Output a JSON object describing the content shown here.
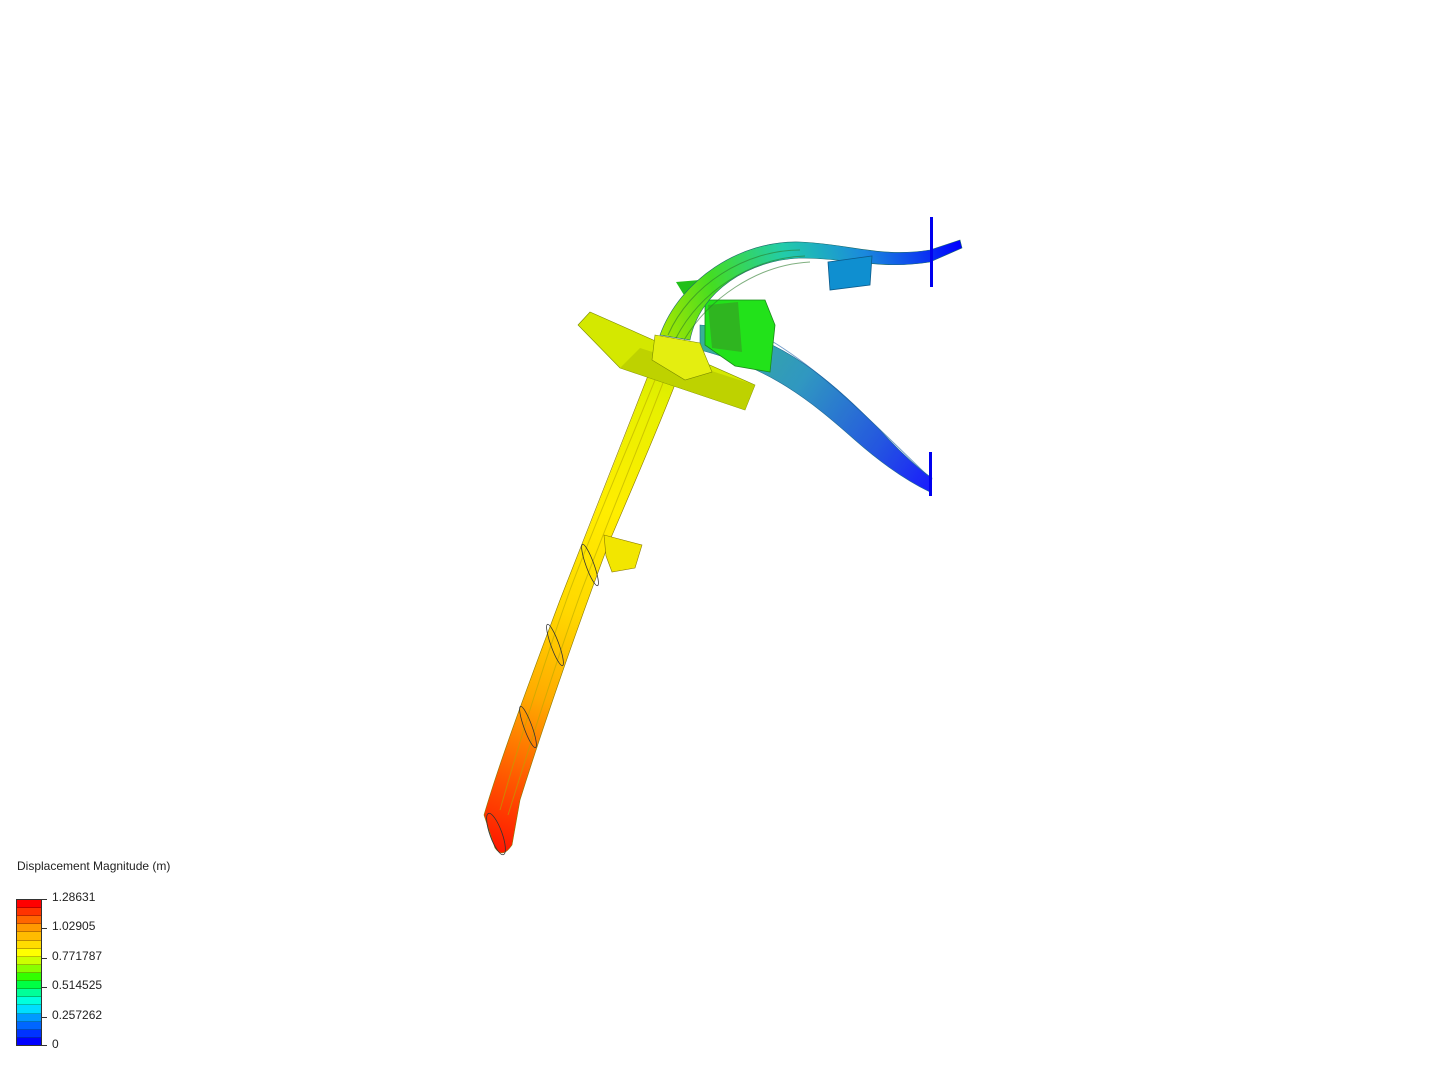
{
  "legend": {
    "title": "Displacement Magnitude (m)",
    "ticks": [
      "1.28631",
      "1.02905",
      "0.771787",
      "0.514525",
      "0.257262",
      "0"
    ],
    "bands": [
      "#ff0000",
      "#ff3300",
      "#ff6600",
      "#ff9900",
      "#ffbb00",
      "#ffdd00",
      "#ffff00",
      "#ccff00",
      "#88ff00",
      "#33ff00",
      "#00ff44",
      "#00ff99",
      "#00ffdd",
      "#00ddff",
      "#0099ff",
      "#0066ff",
      "#0033ff",
      "#0000ff"
    ]
  },
  "colors": {
    "background": "#ffffff",
    "text": "#222222"
  }
}
